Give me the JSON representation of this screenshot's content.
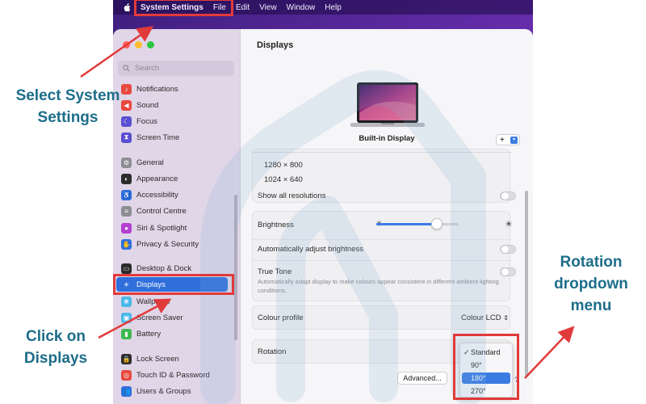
{
  "menubar": {
    "app": "System Settings",
    "items": [
      "File",
      "Edit",
      "View",
      "Window",
      "Help"
    ]
  },
  "sidebar": {
    "search_placeholder": "Search",
    "items": [
      {
        "label": "Notifications",
        "icon": "bell-icon",
        "color": "#e8493f"
      },
      {
        "label": "Sound",
        "icon": "speaker-icon",
        "color": "#e8493f"
      },
      {
        "label": "Focus",
        "icon": "moon-icon",
        "color": "#5a4fd0"
      },
      {
        "label": "Screen Time",
        "icon": "hourglass-icon",
        "color": "#5a4fd0"
      },
      {
        "label": "General",
        "icon": "gear-icon",
        "color": "#8e8e93"
      },
      {
        "label": "Appearance",
        "icon": "appearance-icon",
        "color": "#2b2b2b"
      },
      {
        "label": "Accessibility",
        "icon": "accessibility-icon",
        "color": "#2f6fdc"
      },
      {
        "label": "Control Centre",
        "icon": "control-centre-icon",
        "color": "#8e8e93"
      },
      {
        "label": "Siri & Spotlight",
        "icon": "siri-icon",
        "color": "#b43fd0"
      },
      {
        "label": "Privacy & Security",
        "icon": "hand-icon",
        "color": "#2f6fdc"
      },
      {
        "label": "Desktop & Dock",
        "icon": "dock-icon",
        "color": "#2b2b2b"
      },
      {
        "label": "Displays",
        "icon": "sun-icon",
        "color": "#2f6fdc"
      },
      {
        "label": "Wallpaper",
        "icon": "wallpaper-icon",
        "color": "#4ab8e8"
      },
      {
        "label": "Screen Saver",
        "icon": "screensaver-icon",
        "color": "#4ab8e8"
      },
      {
        "label": "Battery",
        "icon": "battery-icon",
        "color": "#3fb950"
      },
      {
        "label": "Lock Screen",
        "icon": "lock-icon",
        "color": "#2b2b2b"
      },
      {
        "label": "Touch ID & Password",
        "icon": "fingerprint-icon",
        "color": "#e8493f"
      },
      {
        "label": "Users & Groups",
        "icon": "users-icon",
        "color": "#2f6fdc"
      }
    ]
  },
  "content": {
    "title": "Displays",
    "display_name": "Built-in Display",
    "add_button": "+",
    "resolutions": [
      "1280 × 800",
      "1024 × 640"
    ],
    "show_all_resolutions": "Show all resolutions",
    "brightness_label": "Brightness",
    "brightness_level": 0.74,
    "auto_brightness_label": "Automatically adjust brightness",
    "true_tone_label": "True Tone",
    "true_tone_desc": "Automatically adapt display to make colours appear consistent in different ambient lighting conditions.",
    "colour_profile_label": "Colour profile",
    "colour_profile_value": "Colour LCD",
    "rotation_label": "Rotation",
    "rotation_options": [
      "Standard",
      "90°",
      "180°",
      "270°"
    ],
    "rotation_checked": "Standard",
    "rotation_highlighted": "180°",
    "advanced_button": "Advanced...",
    "help_button": "?"
  },
  "annotations": {
    "select_system_settings": "Select System Settings",
    "click_on_displays": "Click on Displays",
    "rotation_dropdown_menu": "Rotation dropdown menu",
    "annotation_color": "#e13a3a",
    "callout_color": "#1d6d8a"
  }
}
